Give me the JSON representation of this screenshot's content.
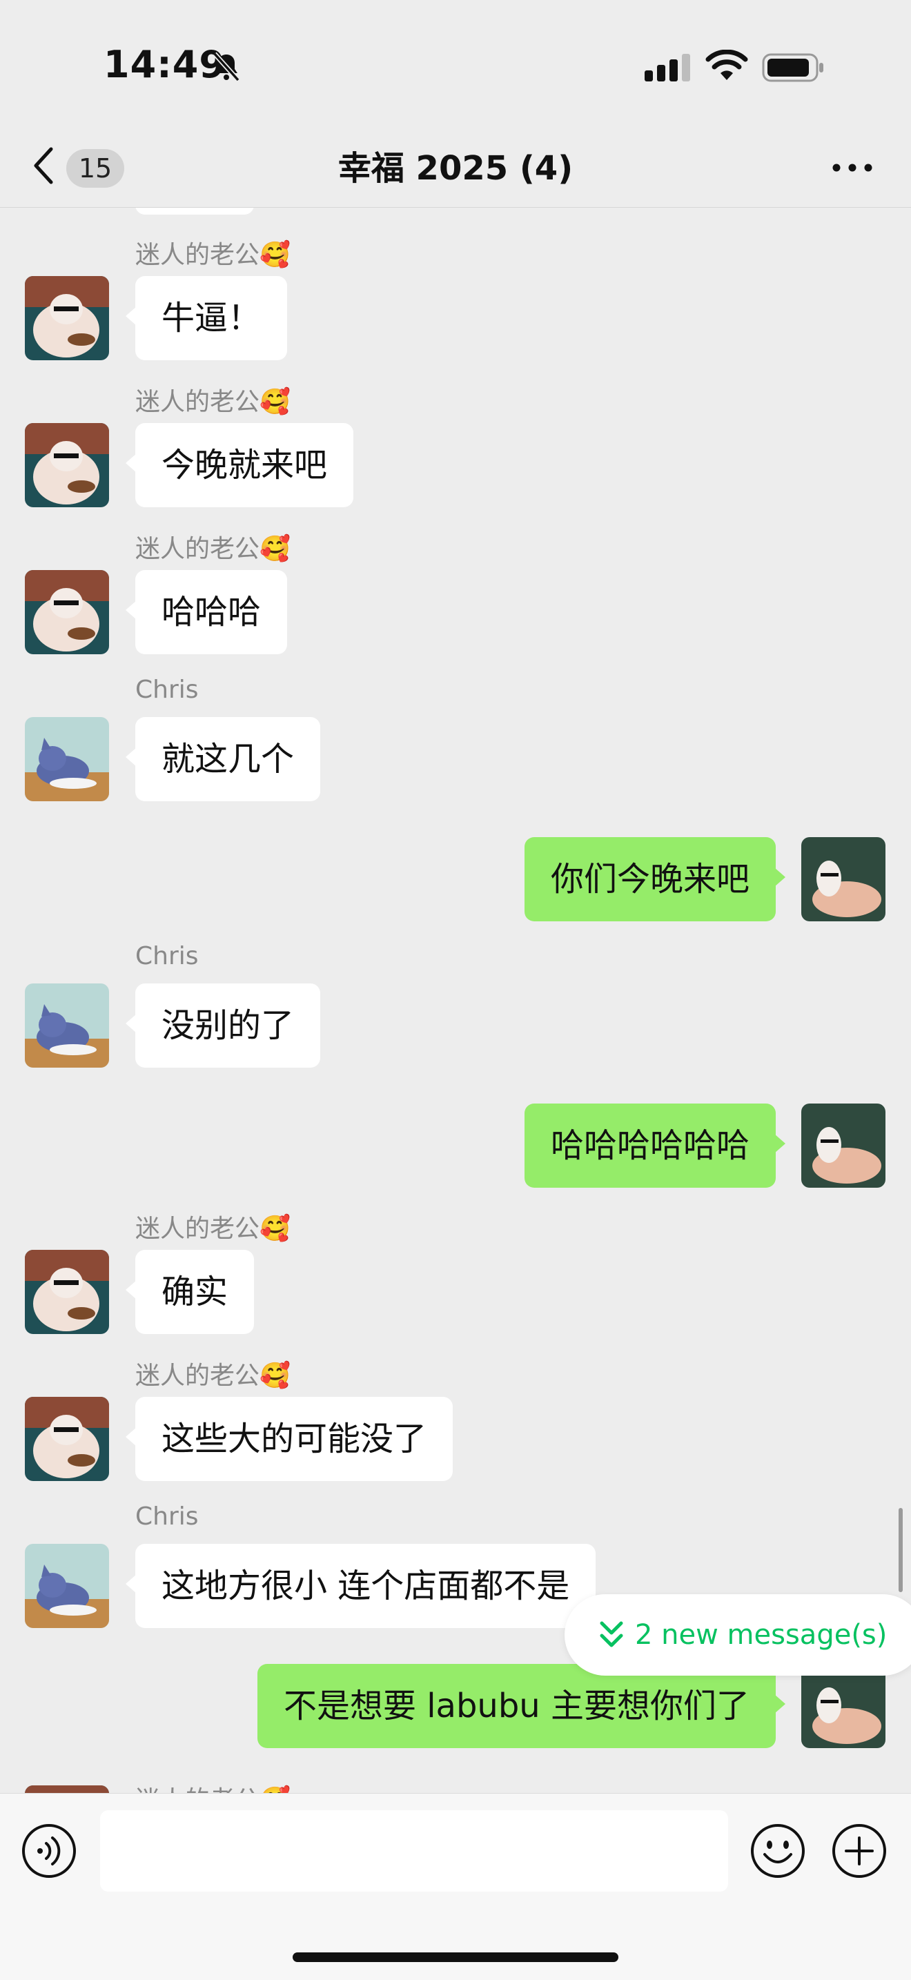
{
  "status_bar": {
    "time": "14:49"
  },
  "nav": {
    "unread_count": "15",
    "title": "幸福 2025 (4)"
  },
  "messages": [
    {
      "side": "in",
      "sender": "迷人的老公🥰",
      "text": "牛逼！",
      "avatar": "sunglasses-cat-avatar"
    },
    {
      "side": "in",
      "sender": "迷人的老公🥰",
      "text": "今晚就来吧",
      "avatar": "sunglasses-cat-avatar"
    },
    {
      "side": "in",
      "sender": "迷人的老公🥰",
      "text": "哈哈哈",
      "avatar": "sunglasses-cat-avatar"
    },
    {
      "side": "in",
      "sender": "Chris",
      "text": "就这几个",
      "avatar": "cartoon-cat-avatar"
    },
    {
      "side": "out",
      "text": "你们今晚来吧",
      "avatar": "cat-on-couch-avatar"
    },
    {
      "side": "in",
      "sender": "Chris",
      "text": "没别的了",
      "avatar": "cartoon-cat-avatar"
    },
    {
      "side": "out",
      "text": "哈哈哈哈哈哈",
      "avatar": "cat-on-couch-avatar"
    },
    {
      "side": "in",
      "sender": "迷人的老公🥰",
      "text": "确实",
      "avatar": "sunglasses-cat-avatar"
    },
    {
      "side": "in",
      "sender": "迷人的老公🥰",
      "text": "这些大的可能没了",
      "avatar": "sunglasses-cat-avatar"
    },
    {
      "side": "in",
      "sender": "Chris",
      "text": "这地方很小 连个店面都不是",
      "avatar": "cartoon-cat-avatar"
    },
    {
      "side": "out",
      "text": "不是想要 labubu 主要想你们了",
      "avatar": "cat-on-couch-avatar"
    },
    {
      "side": "in",
      "sender": "迷人的老公🥰",
      "text": "",
      "avatar": "sunglasses-cat-avatar"
    }
  ],
  "new_messages": {
    "label": "2 new message(s)"
  },
  "input": {
    "value": "",
    "placeholder": ""
  },
  "colors": {
    "outgoing_bubble": "#95ec69",
    "accent_green": "#07c160",
    "background": "#ededed"
  }
}
